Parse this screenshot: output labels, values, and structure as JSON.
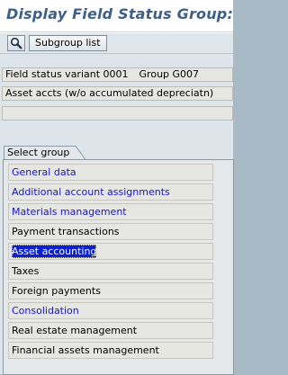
{
  "title": "Display Field Status Group: O",
  "toolbar": {
    "subgroup_button_label": "Subgroup list",
    "details_icon": "magnifier-icon"
  },
  "info": {
    "field_status_variant": "Field status variant 0001",
    "group": "Group G007",
    "description": "Asset accts (w/o accumulated depreciatn)",
    "empty_line": ""
  },
  "select_group": {
    "tab_label": "Select group",
    "items": [
      {
        "label": "General data",
        "style": "link"
      },
      {
        "label": "Additional account assignments",
        "style": "link"
      },
      {
        "label": "Materials management",
        "style": "link"
      },
      {
        "label": "Payment transactions",
        "style": "text"
      },
      {
        "label": "Asset accounting",
        "style": "selected"
      },
      {
        "label": "Taxes",
        "style": "text"
      },
      {
        "label": "Foreign payments",
        "style": "text"
      },
      {
        "label": "Consolidation",
        "style": "link"
      },
      {
        "label": "Real estate management",
        "style": "text"
      },
      {
        "label": "Financial assets management",
        "style": "text"
      }
    ]
  },
  "colors": {
    "title": "#3d5f88",
    "link": "#1414d6",
    "selected_bg": "#0a1fd6",
    "panel_bg": "#dde4ea",
    "field_bg": "#e6e6e2",
    "outer_bg": "#a9bac7"
  }
}
